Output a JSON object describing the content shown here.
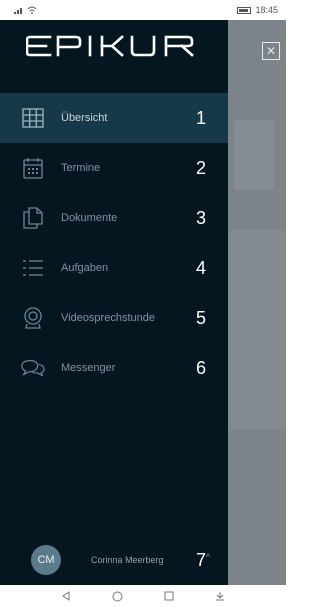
{
  "status_bar": {
    "time": "18:45",
    "signal_icon": "signal-icon",
    "wifi_icon": "wifi-icon",
    "battery_icon": "battery-icon"
  },
  "app": {
    "logo_text": "EPIKUR",
    "close_icon": "close-icon"
  },
  "menu": {
    "items": [
      {
        "label": "Übersicht",
        "icon": "grid-icon",
        "number": "1",
        "active": true
      },
      {
        "label": "Termine",
        "icon": "calendar-icon",
        "number": "2",
        "active": false
      },
      {
        "label": "Dokumente",
        "icon": "documents-icon",
        "number": "3",
        "active": false
      },
      {
        "label": "Aufgaben",
        "icon": "list-icon",
        "number": "4",
        "active": false
      },
      {
        "label": "Videosprechstunde",
        "icon": "webcam-icon",
        "number": "5",
        "active": false
      },
      {
        "label": "Messenger",
        "icon": "chat-icon",
        "number": "6",
        "active": false
      }
    ]
  },
  "footer": {
    "avatar_initials": "CM",
    "user_name": "Corinna Meerberg",
    "number": "7",
    "caret_icon": "caret-up-icon"
  },
  "nav_bar": {
    "back_icon": "back-icon",
    "home_icon": "home-icon",
    "recents_icon": "recents-icon",
    "notification_icon": "notification-icon"
  },
  "colors": {
    "drawer_bg": "#041620",
    "active_bg": "#173848",
    "backdrop": "#7d8489",
    "avatar": "#5b7b8b"
  }
}
